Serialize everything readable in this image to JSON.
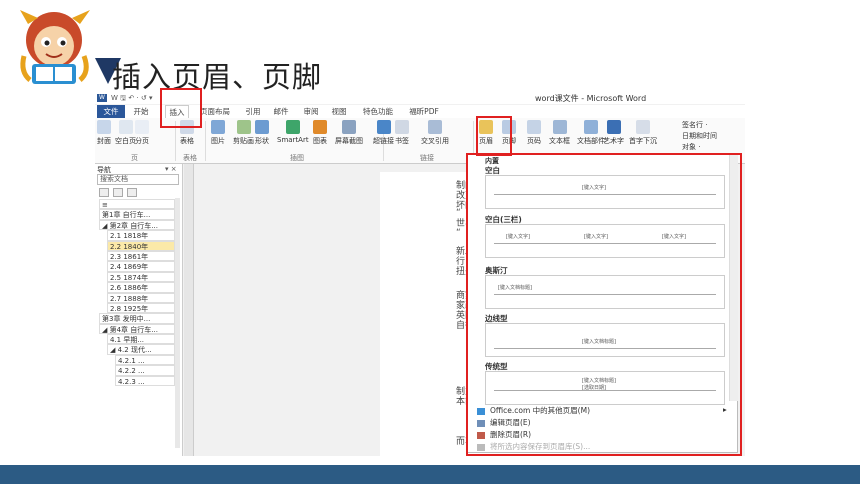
{
  "slide": {
    "title": "插入页眉、页脚",
    "colors": {
      "accent": "#1f3864",
      "footer": "#2c5b84",
      "highlight": "#e02020"
    }
  },
  "word": {
    "window_title": "word课文件 - Microsoft Word",
    "quick_access": "W 🖫 ↶ · ↺ ▾",
    "tabs": [
      "文件",
      "开始",
      "插入",
      "页面布局",
      "引用",
      "邮件",
      "审阅",
      "视图",
      "特色功能",
      "福昕PDF"
    ],
    "active_tab": "插入",
    "ribbon": {
      "buttons": [
        {
          "label": "封面",
          "icon": "cover-page-icon"
        },
        {
          "label": "空白页",
          "icon": "blank-page-icon"
        },
        {
          "label": "分页",
          "icon": "page-break-icon"
        },
        {
          "label": "表格",
          "icon": "table-icon"
        },
        {
          "label": "图片",
          "icon": "picture-icon"
        },
        {
          "label": "剪贴画",
          "icon": "clipart-icon"
        },
        {
          "label": "形状",
          "icon": "shapes-icon"
        },
        {
          "label": "SmartArt",
          "icon": "smartart-icon"
        },
        {
          "label": "图表",
          "icon": "chart-icon"
        },
        {
          "label": "屏幕截图",
          "icon": "screenshot-icon"
        },
        {
          "label": "超链接",
          "icon": "hyperlink-icon"
        },
        {
          "label": "书签",
          "icon": "bookmark-icon"
        },
        {
          "label": "交叉引用",
          "icon": "cross-reference-icon"
        },
        {
          "label": "页眉",
          "icon": "header-icon"
        },
        {
          "label": "页脚",
          "icon": "footer-icon"
        },
        {
          "label": "页码",
          "icon": "page-number-icon"
        },
        {
          "label": "文本框",
          "icon": "textbox-icon"
        },
        {
          "label": "文档部件",
          "icon": "quick-parts-icon"
        },
        {
          "label": "艺术字",
          "icon": "wordart-icon"
        },
        {
          "label": "首字下沉",
          "icon": "dropcap-icon"
        }
      ],
      "groups": [
        "页",
        "表格",
        "插图",
        "链接"
      ],
      "side_items": [
        "签名行 ·",
        "日期和时间",
        "对象 ·"
      ]
    },
    "nav": {
      "title": "导航",
      "close": "▾ ×",
      "search_placeholder": "搜索文档",
      "items": [
        {
          "label": "≡",
          "indent": 0,
          "selected": false
        },
        {
          "label": "第1章 自行车...",
          "indent": 0,
          "selected": false
        },
        {
          "label": "◢ 第2章 自行车...",
          "indent": 0,
          "selected": false
        },
        {
          "label": "2.1  1818年",
          "indent": 1,
          "selected": false
        },
        {
          "label": "2.2  1840年",
          "indent": 1,
          "selected": true
        },
        {
          "label": "2.3  1861年",
          "indent": 1,
          "selected": false
        },
        {
          "label": "2.4  1869年",
          "indent": 1,
          "selected": false
        },
        {
          "label": "2.5  1874年",
          "indent": 1,
          "selected": false
        },
        {
          "label": "2.6  1886年",
          "indent": 1,
          "selected": false
        },
        {
          "label": "2.7  1888年",
          "indent": 1,
          "selected": false
        },
        {
          "label": "2.8  1925年",
          "indent": 1,
          "selected": false
        },
        {
          "label": "第3章 发明中...",
          "indent": 0,
          "selected": false
        },
        {
          "label": "◢ 第4章 自行车...",
          "indent": 0,
          "selected": false
        },
        {
          "label": "4.1  早期...",
          "indent": 1,
          "selected": false
        },
        {
          "label": "◢ 4.2  现代...",
          "indent": 1,
          "selected": false
        },
        {
          "label": "4.2.1 ...",
          "indent": 2,
          "selected": false
        },
        {
          "label": "4.2.2 ...",
          "indent": 2,
          "selected": false
        },
        {
          "label": "4.2.3 ...",
          "indent": 2,
          "selected": false
        }
      ]
    },
    "doc_fragments": [
      "制的",
      "改变",
      "坏的",
      "“",
      "世界",
      "“",
      "新发",
      "行",
      "扭头",
      "商家",
      "家改",
      "英国",
      "自行",
      "制力",
      "本能",
      "而车"
    ],
    "dropdown": {
      "header": "内置",
      "sections": [
        {
          "title": "空白",
          "placeholders": [
            "[键入文字]"
          ]
        },
        {
          "title": "空白(三栏)",
          "placeholders": [
            "[键入文字]",
            "[键入文字]",
            "[键入文字]"
          ]
        },
        {
          "title": "奥斯汀",
          "placeholders": [
            "[键入文档标题]"
          ]
        },
        {
          "title": "边线型",
          "placeholders": [
            "[键入文档标题]"
          ]
        },
        {
          "title": "传统型",
          "placeholders": [
            "[键入文档标题]",
            "[选取日期]"
          ]
        }
      ],
      "menu": [
        {
          "label": "Office.com 中的其他页眉(M)",
          "icon": "office-globe-icon",
          "disabled": false,
          "arrow": "▸"
        },
        {
          "label": "编辑页眉(E)",
          "icon": "edit-header-icon",
          "disabled": false
        },
        {
          "label": "删除页眉(R)",
          "icon": "remove-header-icon",
          "disabled": false
        },
        {
          "label": "将所选内容保存到页眉库(S)...",
          "icon": "save-gallery-icon",
          "disabled": true
        }
      ]
    }
  }
}
